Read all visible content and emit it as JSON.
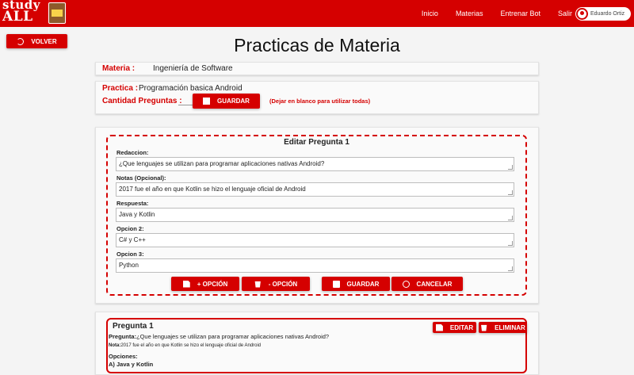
{
  "nav": {
    "logo_top": "study",
    "logo_bottom": "ALL",
    "links": [
      "Inicio",
      "Materias",
      "Entrenar Bot",
      "Salir"
    ],
    "user_name": "Eduardo Ortiz"
  },
  "back_button": "VOLVER",
  "page_title": "Practicas de Materia",
  "materia": {
    "label": "Materia :",
    "value": "Ingeniería de Software"
  },
  "practica": {
    "label": "Practica :",
    "value": "Programación basica Android",
    "cantidad_label": "Cantidad Preguntas :",
    "cantidad_value": "",
    "save_button": "GUARDAR",
    "hint": "(Dejar en blanco para utilizar todas)"
  },
  "edit_form": {
    "title": "Editar Pregunta 1",
    "fields": [
      {
        "label": "Redaccion:",
        "value": "¿Que lenguajes se utilizan para programar aplicaciones nativas Android?"
      },
      {
        "label": "Notas (Opcional):",
        "value": "2017 fue el año en que Kotlin se hizo el lenguaje oficial de Android"
      },
      {
        "label": "Respuesta:",
        "value": "Java y Kotlin"
      },
      {
        "label": "Opcion 2:",
        "value": "C# y C++"
      },
      {
        "label": "Opcion 3:",
        "value": "Python"
      }
    ],
    "buttons": {
      "add_option": "+ OPCIÓN",
      "remove_option": "- OPCIÓN",
      "save": "GUARDAR",
      "cancel": "CANCELAR"
    }
  },
  "question_card": {
    "title": "Pregunta 1",
    "edit_button": "EDITAR",
    "delete_button": "ELIMINAR",
    "pregunta_label": "Pregunta:",
    "pregunta_value": "¿Que lenguajes se utilizan para programar aplicaciones nativas Android?",
    "nota_label": "Nota:",
    "nota_value": "2017 fue el año en que Kotlin se hizo el lenguaje oficial de Android",
    "opciones_label": "Opciones:",
    "first_option": "A) Java y Kotlin"
  },
  "colors": {
    "accent": "#d50000",
    "background": "#f4f4f4"
  }
}
